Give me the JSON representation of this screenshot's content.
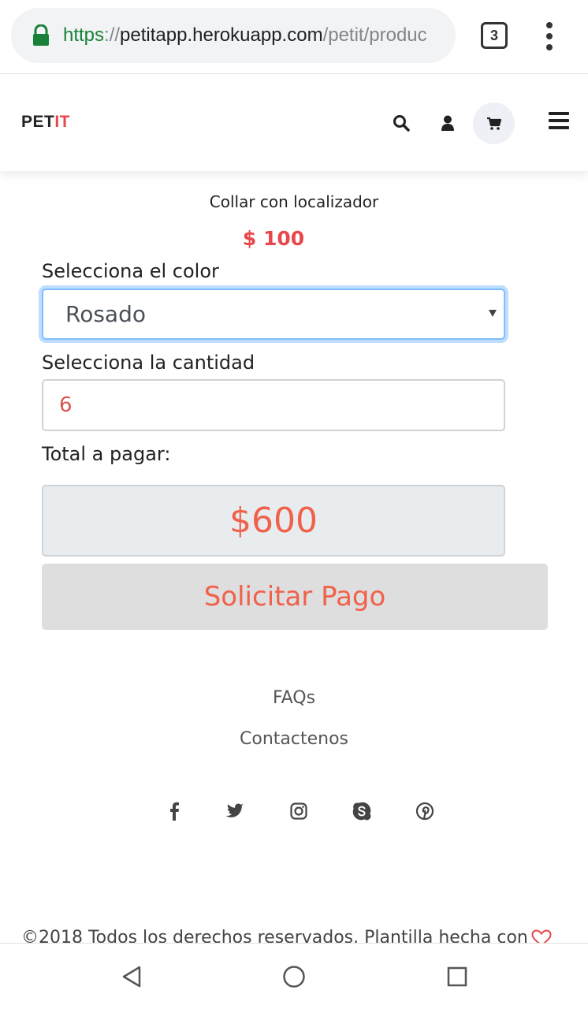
{
  "browser": {
    "url_scheme": "https",
    "url_separator": "://",
    "url_host": "petitapp.herokuapp.com",
    "url_path": "/petit/produc",
    "tab_count": "3",
    "icons": [
      "lock-icon",
      "tabs-icon",
      "menu-kebab-icon"
    ]
  },
  "header": {
    "logo_part1": "PET",
    "logo_part2": "IT",
    "logo_accent_color": "#e8464a",
    "icons": [
      "search-icon",
      "user-icon",
      "cart-icon",
      "hamburger-icon"
    ]
  },
  "product": {
    "title": "Collar con localizador",
    "price": "$ 100",
    "color_label": "Selecciona el color",
    "color_selected": "Rosado",
    "quantity_label": "Selecciona la cantidad",
    "quantity_value": "6",
    "total_label": "Total a pagar:",
    "total_value": "$600",
    "pay_button": "Solicitar Pago",
    "accent_color": "#f0614a"
  },
  "footer": {
    "links": [
      "FAQs",
      "Contactenos"
    ],
    "social_icons": [
      "facebook-icon",
      "twitter-icon",
      "instagram-icon",
      "skype-icon",
      "pinterest-icon"
    ],
    "copyright": "©2018 Todos los derechos reservados. Plantilla hecha con"
  },
  "system_nav": {
    "icons": [
      "back-icon",
      "home-icon",
      "recents-icon"
    ]
  }
}
